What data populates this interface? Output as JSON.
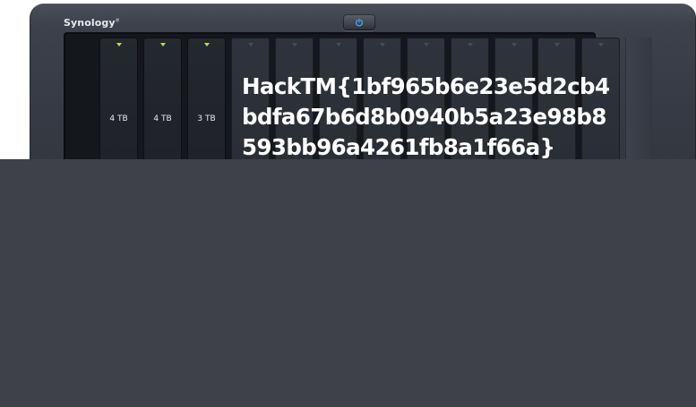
{
  "device": {
    "brand": "Synology",
    "brand_mark": "®",
    "colors": {
      "chassis": "#3c414b",
      "led_active": "#b6e04a",
      "overlay": "#3e4149",
      "text": "#ffffff"
    }
  },
  "drive_bays": [
    {
      "capacity": "4 TB",
      "status": "active"
    },
    {
      "capacity": "4 TB",
      "status": "active"
    },
    {
      "capacity": "3 TB",
      "status": "active"
    },
    {
      "capacity": "",
      "status": "empty"
    },
    {
      "capacity": "",
      "status": "empty"
    },
    {
      "capacity": "",
      "status": "empty"
    },
    {
      "capacity": "",
      "status": "empty"
    },
    {
      "capacity": "",
      "status": "empty"
    },
    {
      "capacity": "",
      "status": "empty"
    },
    {
      "capacity": "",
      "status": "empty"
    },
    {
      "capacity": "",
      "status": "empty"
    },
    {
      "capacity": "",
      "status": "empty"
    }
  ],
  "overlay_text": "HackTM{1bf965b6e23e5d2cb4bdfa67b6d8b0940b5a23e98b8593bb96a4261fb8a1f66a}",
  "icons": {
    "power": "power-icon"
  }
}
